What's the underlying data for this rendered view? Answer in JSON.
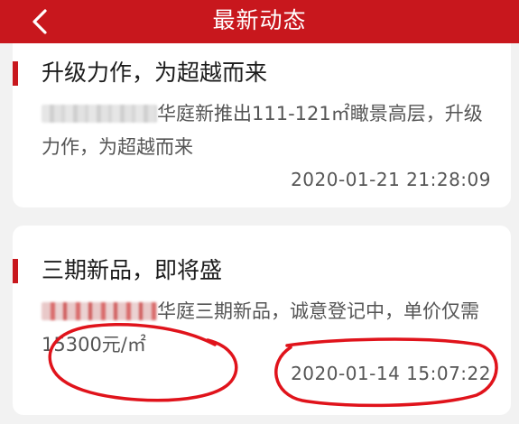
{
  "header": {
    "title": "最新动态",
    "back_icon": "chevron-left-icon",
    "background": "#c8171d"
  },
  "news": [
    {
      "title": "升级力作，为超越而来",
      "body_visible": "华庭新推出111-121㎡瞰景高层，升级力作，为超越而来",
      "time": "2020-01-21 21:28:09"
    },
    {
      "title": "三期新品，即将盛",
      "body_visible": "华庭三期新品，诚意登记中，单价仅需15300元/㎡",
      "time": "2020-01-14 15:07:22"
    }
  ],
  "annotation_color": "#e0131b"
}
